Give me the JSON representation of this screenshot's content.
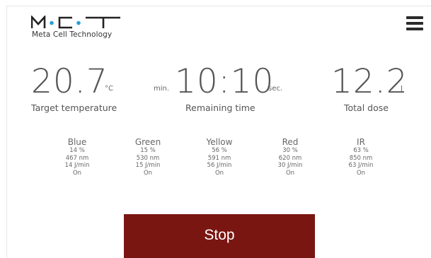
{
  "brand": {
    "logo_text": "M·C·T",
    "subtitle": "Meta Cell Technology",
    "accent_color": "#2a9fd8"
  },
  "menu": {
    "icon": "hamburger-menu-icon"
  },
  "stats": {
    "temperature": {
      "value": "20.7",
      "unit": "°C",
      "label": "Target temperature"
    },
    "time": {
      "unit_pre": "min.",
      "value": "10:10",
      "unit_post": "sec.",
      "label": "Remaining time"
    },
    "dose": {
      "value": "12.2",
      "unit": "J",
      "label": "Total dose"
    }
  },
  "channels": [
    {
      "name": "Blue",
      "percent": "14 %",
      "wavelength": "467 nm",
      "rate": "14 J/min",
      "state": "On"
    },
    {
      "name": "Green",
      "percent": "15 %",
      "wavelength": "530 nm",
      "rate": "15 J/min",
      "state": "On"
    },
    {
      "name": "Yellow",
      "percent": "56 %",
      "wavelength": "591 nm",
      "rate": "56 J/min",
      "state": "On"
    },
    {
      "name": "Red",
      "percent": "30 %",
      "wavelength": "620 nm",
      "rate": "30 J/min",
      "state": "On"
    },
    {
      "name": "IR",
      "percent": "63 %",
      "wavelength": "850 nm",
      "rate": "63 J/min",
      "state": "On"
    }
  ],
  "actions": {
    "stop_label": "Stop",
    "stop_color": "#7a1612"
  }
}
